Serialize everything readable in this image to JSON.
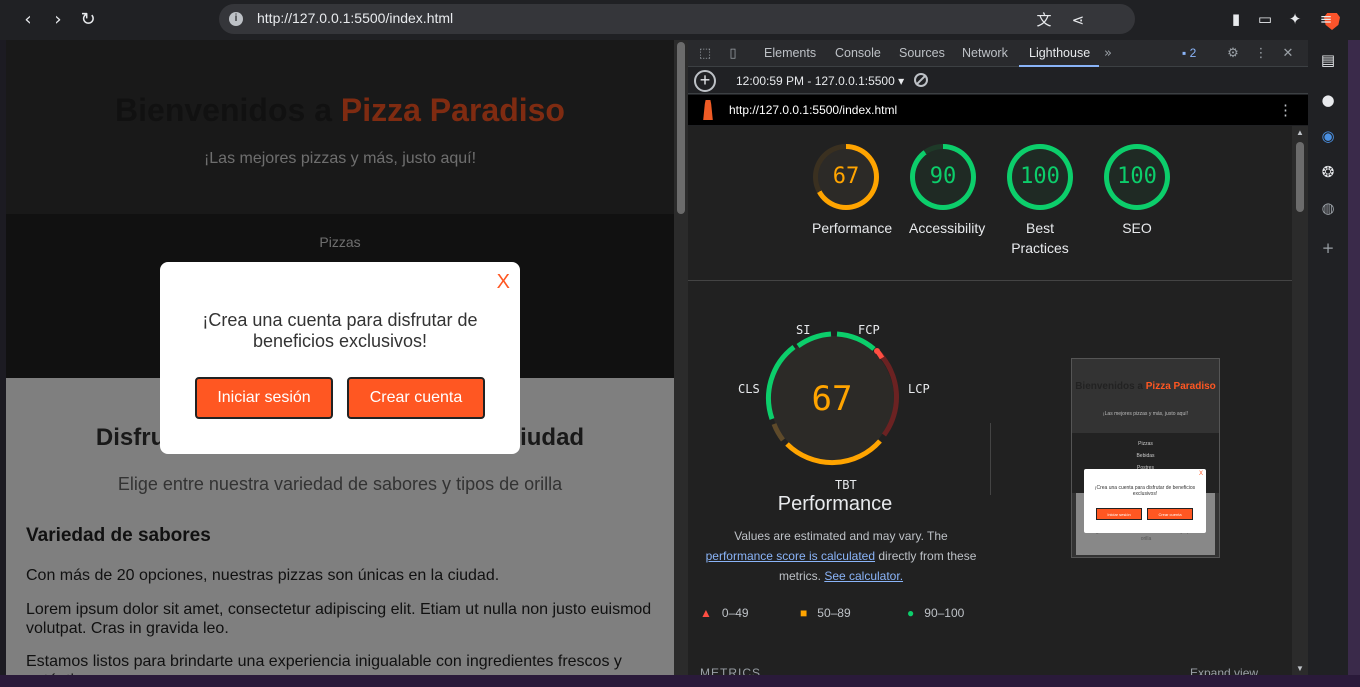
{
  "browser": {
    "url": "http://127.0.0.1:5500/index.html"
  },
  "page": {
    "title_part1": "Bienvenidos a ",
    "title_brand": "Pizza Paradiso",
    "subtitle": "¡Las mejores pizzas y más, justo aquí!",
    "nav_item": "Pizzas",
    "section_title": "Disfruta de las mejores pizzas de la ciudad",
    "section_lead": "Elige entre nuestra variedad de sabores y tipos de orilla",
    "subheading": "Variedad de sabores",
    "p1": "Con más de 20 opciones, nuestras pizzas son únicas en la ciudad.",
    "p2": "Lorem ipsum dolor sit amet, consectetur adipiscing elit. Etiam ut nulla non justo euismod volutpat. Cras in gravida leo.",
    "p3": "Estamos listos para brindarte una experiencia inigualable con ingredientes frescos y auténticos."
  },
  "modal": {
    "close": "X",
    "message": "¡Crea una cuenta para disfrutar de beneficios exclusivos!",
    "login": "Iniciar sesión",
    "signup": "Crear cuenta"
  },
  "devtools": {
    "tabs": [
      "Elements",
      "Console",
      "Sources",
      "Network",
      "Lighthouse"
    ],
    "issues_count": "2",
    "report_label": "12:00:59 PM - 127.0.0.1:5500",
    "report_url": "http://127.0.0.1:5500/index.html"
  },
  "lighthouse": {
    "scores": [
      {
        "label": "Performance",
        "value": "67",
        "color": "#ffa400"
      },
      {
        "label": "Accessibility",
        "value": "90",
        "color": "#0cce6b"
      },
      {
        "label": "Best Practices",
        "value": "100",
        "color": "#0cce6b"
      },
      {
        "label": "SEO",
        "value": "100",
        "color": "#0cce6b"
      }
    ],
    "perf_score": "67",
    "perf_title": "Performance",
    "metrics": [
      "SI",
      "FCP",
      "LCP",
      "TBT",
      "CLS"
    ],
    "note_1": "Values are estimated and may vary. The",
    "note_link1": "performance score is calculated",
    "note_2": "directly from these metrics.",
    "note_link2": "See calculator.",
    "legend": [
      "0–49",
      "50–89",
      "90–100"
    ],
    "metrics_header": "METRICS",
    "expand": "Expand view",
    "thumb_title1": "Bienvenidos a ",
    "thumb_brand": "Pizza Paradiso",
    "thumb_sub": "¡Las mejores pizzas y más, justo aquí!",
    "thumb_nav": [
      "Pizzas",
      "Bebidas",
      "Postres"
    ],
    "thumb_bottom": "Elige entre nuestra variedad de sabores y tipos de orilla"
  }
}
